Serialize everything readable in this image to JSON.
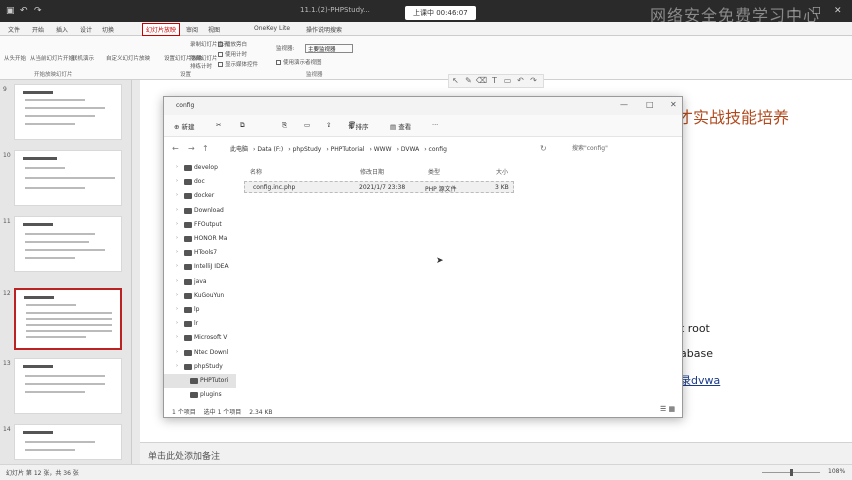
{
  "titlebar": {
    "title": "11.1.(2)-PHPStudy...",
    "share": "上课中 00:46:07",
    "watermark": "网络安全免费学习中心"
  },
  "ribbon_tabs": [
    "文件",
    "开始",
    "插入",
    "设计",
    "切换",
    "幻灯片放映",
    "审阅",
    "视图",
    "OneKey Lite",
    "操作说明搜索"
  ],
  "active_tab": "幻灯片放映",
  "ribbon": {
    "g1": "从头开始",
    "g2": "从当前幻灯片开始",
    "g3": "联机演示",
    "g4": "自定义幻灯片放映",
    "g5": "设置幻灯片放映",
    "g6": "隐藏幻灯片",
    "g7": "排练计时",
    "g8": "录制幻灯片演示",
    "chk1": "播放旁白",
    "chk2": "使用计时",
    "chk3": "显示媒体控件",
    "chk4": "使用演示者视图",
    "monitor_label": "监视器:",
    "monitor_value": "主要监视器",
    "lbl1": "开始放映幻灯片",
    "lbl2": "设置",
    "lbl3": "监视器"
  },
  "slides": [
    {
      "num": "9"
    },
    {
      "num": "10"
    },
    {
      "num": "11"
    },
    {
      "num": "12"
    },
    {
      "num": "13"
    },
    {
      "num": "14"
    }
  ],
  "slide": {
    "heading": "才实战技能培养",
    "line1": "t root",
    "line2": "abase",
    "line3": "录dvwa"
  },
  "notes_placeholder": "单击此处添加备注",
  "statusbar": {
    "left": "幻灯片 第 12 张，共 36 张",
    "zoom": "108%"
  },
  "explorer": {
    "title": "config",
    "cmd": {
      "new": "新建",
      "sort": "排序",
      "view": "查看",
      "more": "···"
    },
    "breadcrumbs": [
      "此电脑",
      "Data (F:)",
      "phpStudy",
      "PHPTutorial",
      "WWW",
      "DVWA",
      "config"
    ],
    "search_placeholder": "搜索\"config\"",
    "nav": [
      {
        "label": "develop",
        "highlight": false,
        "sub": false
      },
      {
        "label": "doc",
        "highlight": false,
        "sub": false
      },
      {
        "label": "docker",
        "highlight": false,
        "sub": false
      },
      {
        "label": "Download",
        "highlight": false,
        "sub": false
      },
      {
        "label": "FFOutput",
        "highlight": false,
        "sub": false
      },
      {
        "label": "HONOR Ma",
        "highlight": false,
        "sub": false
      },
      {
        "label": "HTools7",
        "highlight": false,
        "sub": false
      },
      {
        "label": "IntelliJ IDEA",
        "highlight": false,
        "sub": false
      },
      {
        "label": "java",
        "highlight": false,
        "sub": false
      },
      {
        "label": "KuGouYun",
        "highlight": false,
        "sub": false
      },
      {
        "label": "lp",
        "highlight": false,
        "sub": false
      },
      {
        "label": "lr",
        "highlight": false,
        "sub": false
      },
      {
        "label": "Microsoft V",
        "highlight": false,
        "sub": false
      },
      {
        "label": "Ntec Downl",
        "highlight": false,
        "sub": false
      },
      {
        "label": "phpStudy",
        "highlight": false,
        "sub": false
      },
      {
        "label": "PHPTutori",
        "highlight": true,
        "sub": true
      },
      {
        "label": "plugins",
        "highlight": false,
        "sub": true
      }
    ],
    "columns": {
      "name": "名称",
      "date": "修改日期",
      "type": "类型",
      "size": "大小"
    },
    "files": [
      {
        "name": "config.inc.php",
        "date": "2021/1/7 23:38",
        "type": "PHP 源文件",
        "size": "3 KB"
      }
    ],
    "status": {
      "items": "1 个项目",
      "selected": "选中 1 个项目",
      "size": "2.34 KB"
    }
  }
}
